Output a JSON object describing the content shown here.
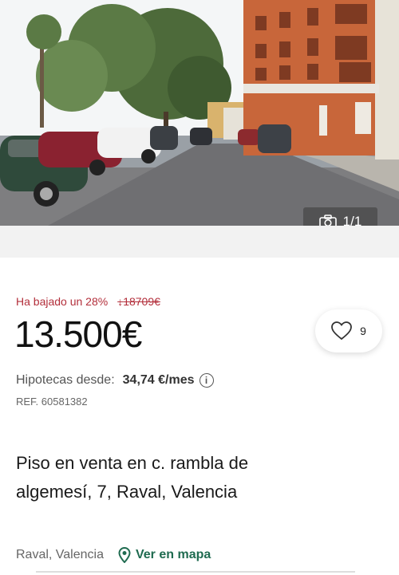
{
  "photo": {
    "counter": "1/1"
  },
  "price": {
    "drop_text": "Ha bajado un 28%",
    "old_price": "18709€",
    "current": "13.500€"
  },
  "favorite": {
    "count": "9"
  },
  "mortgage": {
    "label": "Hipotecas desde:",
    "amount": "34,74 €/mes"
  },
  "ref": "REF. 60581382",
  "title": "Piso en venta en c. rambla de algemesí, 7, Raval, Valencia",
  "location": {
    "area": "Raval, Valencia",
    "map_link": "Ver en mapa"
  },
  "colors": {
    "accent": "#1f6b50",
    "price_drop": "#b32f3b"
  }
}
